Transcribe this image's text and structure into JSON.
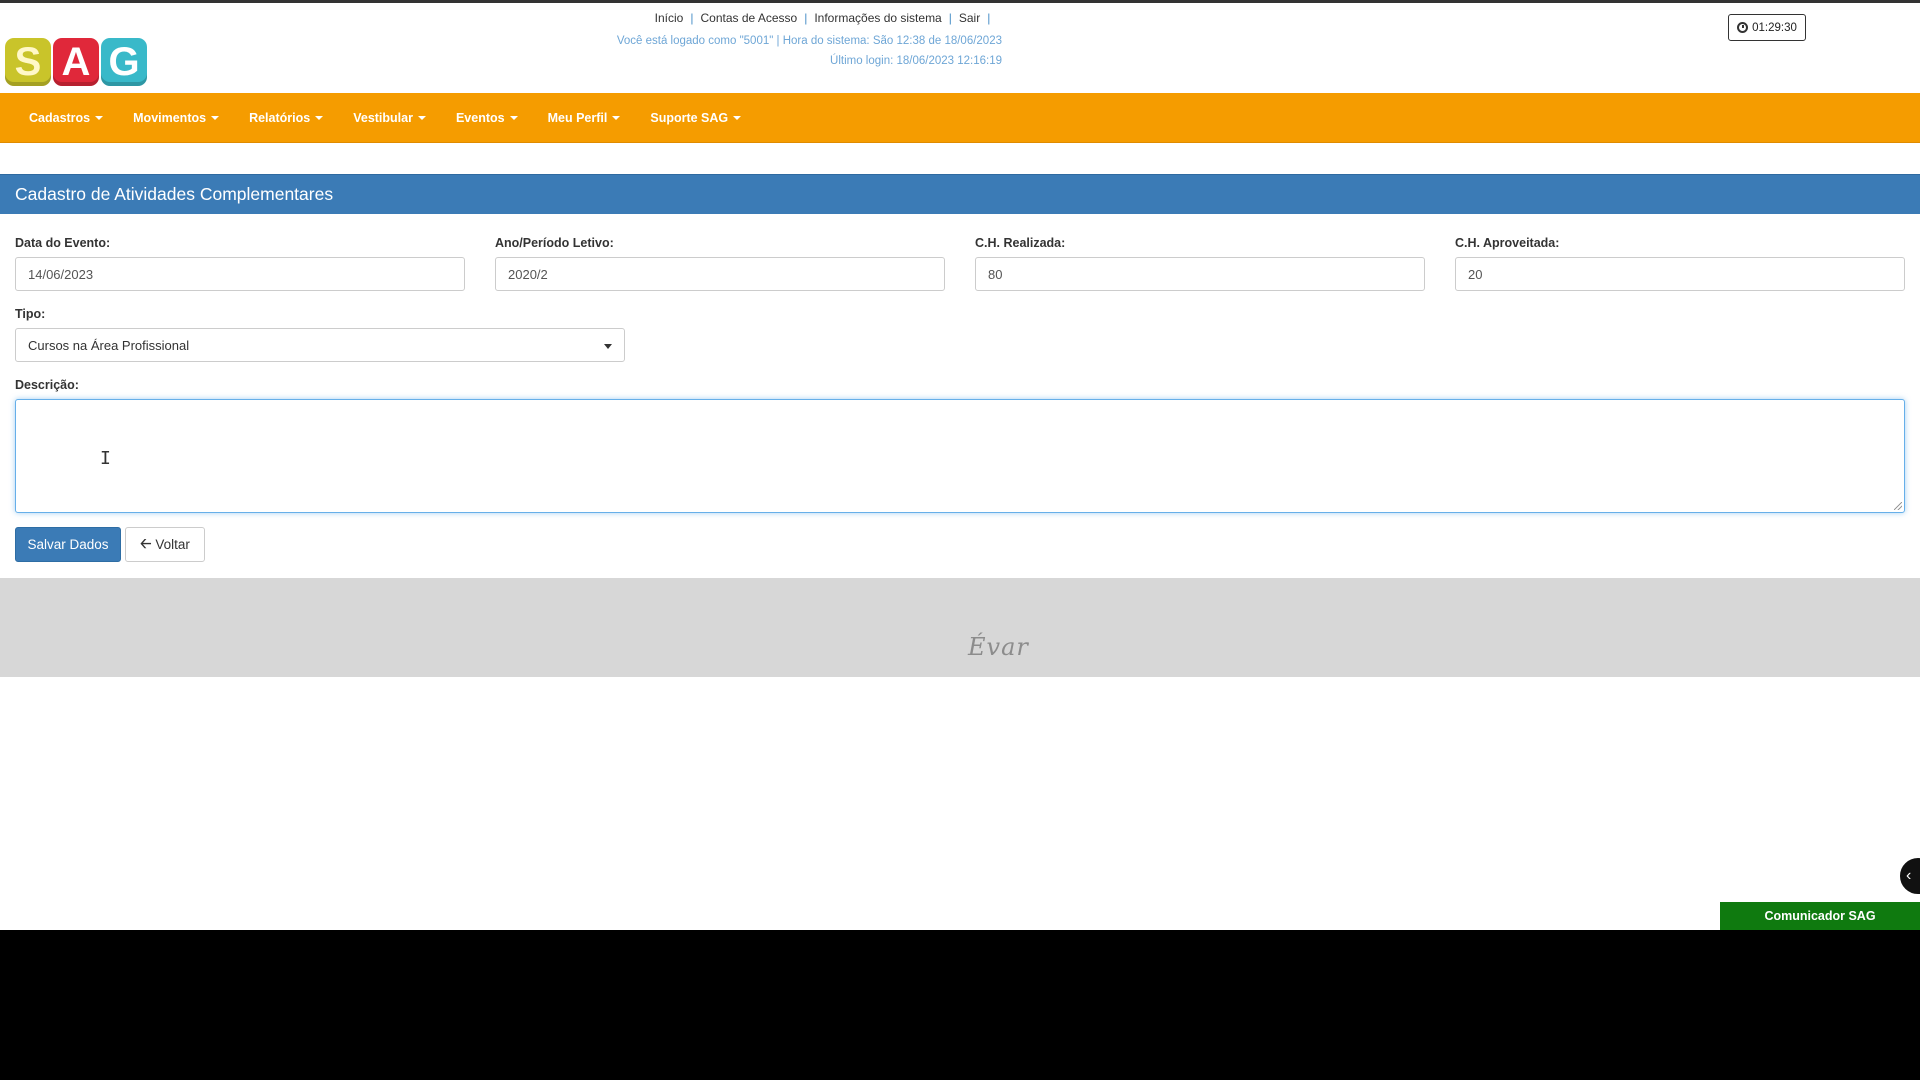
{
  "header": {
    "logo_letters": [
      "S",
      "A",
      "G"
    ],
    "links": [
      "Início",
      "Contas de Acesso",
      "Informações do sistema",
      "Sair"
    ],
    "login_line": "Você está logado como \"5001\" | Hora do sistema: São 12:38 de 18/06/2023",
    "last_login": "Último login: 18/06/2023 12:16:19",
    "session_timer": "01:29:30"
  },
  "nav": {
    "items": [
      "Cadastros",
      "Movimentos",
      "Relatórios",
      "Vestibular",
      "Eventos",
      "Meu Perfil",
      "Suporte SAG"
    ]
  },
  "panel": {
    "title": "Cadastro de Atividades Complementares"
  },
  "form": {
    "data_evento": {
      "label": "Data do Evento:",
      "value": "14/06/2023"
    },
    "ano_periodo": {
      "label": "Ano/Período Letivo:",
      "value": "2020/2"
    },
    "ch_realizada": {
      "label": "C.H. Realizada:",
      "value": "80"
    },
    "ch_aproveitada": {
      "label": "C.H. Aproveitada:",
      "value": "20"
    },
    "tipo": {
      "label": "Tipo:",
      "value": "Cursos na Área Profissional"
    },
    "descricao": {
      "label": "Descrição:",
      "value": ""
    },
    "save_label": "Salvar Dados",
    "back_label": "Voltar"
  },
  "footer": {
    "logo_text": "Évar"
  },
  "widgets": {
    "comunicador_label": "Comunicador SAG"
  },
  "colors": {
    "navbar": "#f59c00",
    "panel_header": "#3b7bb6",
    "primary_button": "#3b7bb6",
    "comunicador": "#0f7a0f"
  }
}
